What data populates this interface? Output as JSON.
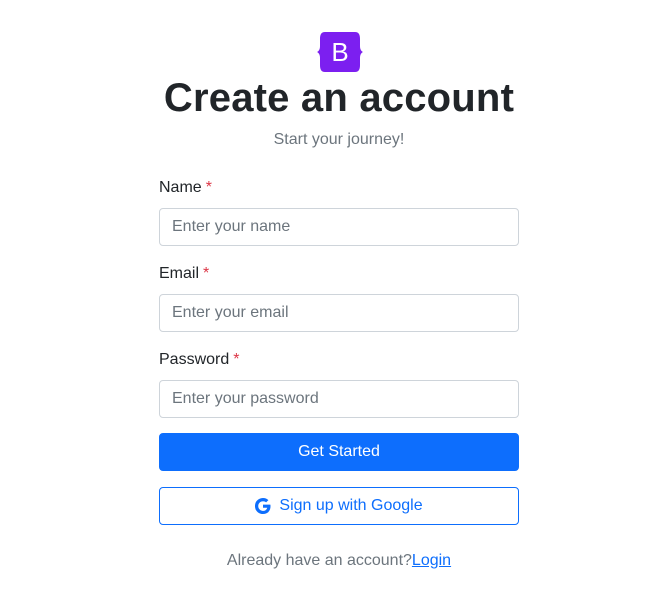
{
  "brand": {
    "logo_letter": "B",
    "logo_color": "#7c1ff0"
  },
  "header": {
    "title": "Create an account",
    "subtitle": "Start your journey!"
  },
  "form": {
    "name": {
      "label": "Name",
      "required_mark": "*",
      "placeholder": "Enter your name",
      "value": ""
    },
    "email": {
      "label": "Email",
      "required_mark": "*",
      "placeholder": "Enter your email",
      "value": ""
    },
    "password": {
      "label": "Password",
      "required_mark": "*",
      "placeholder": "Enter your password",
      "value": ""
    }
  },
  "actions": {
    "submit_label": "Get Started",
    "google_label": "Sign up with Google",
    "google_icon": "google-g-icon"
  },
  "footer": {
    "prompt": "Already have an account?",
    "login_link": "Login"
  },
  "colors": {
    "primary": "#0d6efd",
    "danger": "#dc3545",
    "muted": "#6c757d"
  }
}
